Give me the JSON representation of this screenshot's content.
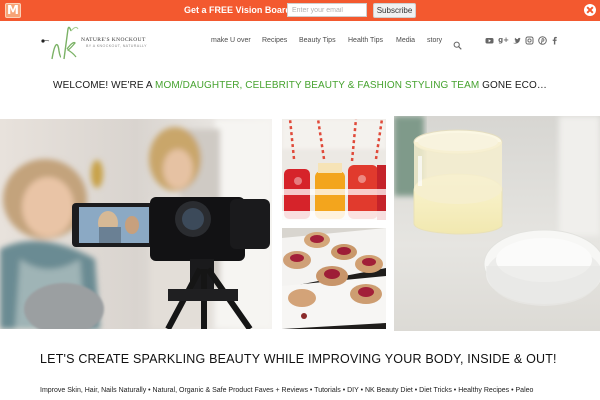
{
  "promo_bar": {
    "brand_initial": "M",
    "message": "Get a FREE Vision Board!",
    "email_placeholder": "Enter your email",
    "subscribe_label": "Subscribe"
  },
  "logo": {
    "monogram": "nk",
    "title": "NATURE'S KNOCKOUT",
    "tagline": "BY A KNOCKOUT, NATURALLY"
  },
  "nav": {
    "items": [
      {
        "label": "make U over"
      },
      {
        "label": "Recipes"
      },
      {
        "label": "Beauty Tips"
      },
      {
        "label": "Health Tips"
      },
      {
        "label": "Media"
      },
      {
        "label": "story"
      }
    ],
    "search_icon": "search-icon",
    "social_icons": [
      "youtube-icon",
      "google-plus-icon",
      "twitter-icon",
      "instagram-icon",
      "pinterest-icon",
      "facebook-icon"
    ]
  },
  "welcome": {
    "prefix": "WELCOME! WE'RE A ",
    "highlight": "MOM/DAUGHTER, CELEBRITY BEAUTY & FASHION STYLING TEAM",
    "suffix": " GONE ECO…"
  },
  "headline": "Let's create sparkling beauty while improving your body, inside & out!",
  "tags_line": "Improve Skin, Hair, Nails Naturally • Natural, Organic & Safe Product Faves + Reviews • Tutorials • DIY • NK Beauty Diet • Diet Tricks • Healthy Recipes • Paleo",
  "colors": {
    "promo_bar": "#f3592f",
    "accent_green": "#46a32f",
    "nav_text": "#4c4c4c"
  }
}
